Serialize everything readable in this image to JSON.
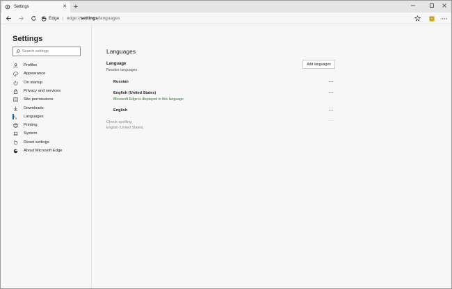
{
  "tab": {
    "title": "Settings",
    "close": "✕",
    "new_tab": "+"
  },
  "window_controls": {
    "minimize": "–",
    "maximize": "□",
    "close": "✕"
  },
  "toolbar": {
    "app_label": "Edge",
    "separator": "|",
    "url_scheme": "edge://",
    "url_host": "settings",
    "url_path": "/languages"
  },
  "sidebar": {
    "title": "Settings",
    "search_placeholder": "Search settings",
    "items": [
      {
        "label": "Profiles",
        "icon": "person-icon"
      },
      {
        "label": "Appearance",
        "icon": "palette-icon"
      },
      {
        "label": "On startup",
        "icon": "power-icon"
      },
      {
        "label": "Privacy and services",
        "icon": "lock-icon"
      },
      {
        "label": "Site permissions",
        "icon": "site-permissions-icon"
      },
      {
        "label": "Downloads",
        "icon": "download-icon"
      },
      {
        "label": "Languages",
        "icon": "languages-icon",
        "active": true
      },
      {
        "label": "Printing",
        "icon": "printer-icon"
      },
      {
        "label": "System",
        "icon": "laptop-icon"
      },
      {
        "label": "Reset settings",
        "icon": "reset-icon"
      },
      {
        "label": "About Microsoft Edge",
        "icon": "edge-logo-icon"
      }
    ]
  },
  "main": {
    "heading": "Languages",
    "language_section": {
      "title": "Language",
      "subtitle": "Reorder languages",
      "add_button": "Add languages",
      "languages": [
        {
          "name": "Russian",
          "note": ""
        },
        {
          "name": "English (United States)",
          "note": "Microsoft Edge is displayed in this language"
        },
        {
          "name": "English",
          "note": ""
        }
      ],
      "more_label": "···"
    },
    "spell_check": {
      "title": "Check spelling",
      "subtitle": "English (United States)",
      "more_label": "···"
    }
  },
  "colors": {
    "accent": "#0067b8",
    "note_green": "#2e7d32",
    "background": "#f7f7f7"
  }
}
